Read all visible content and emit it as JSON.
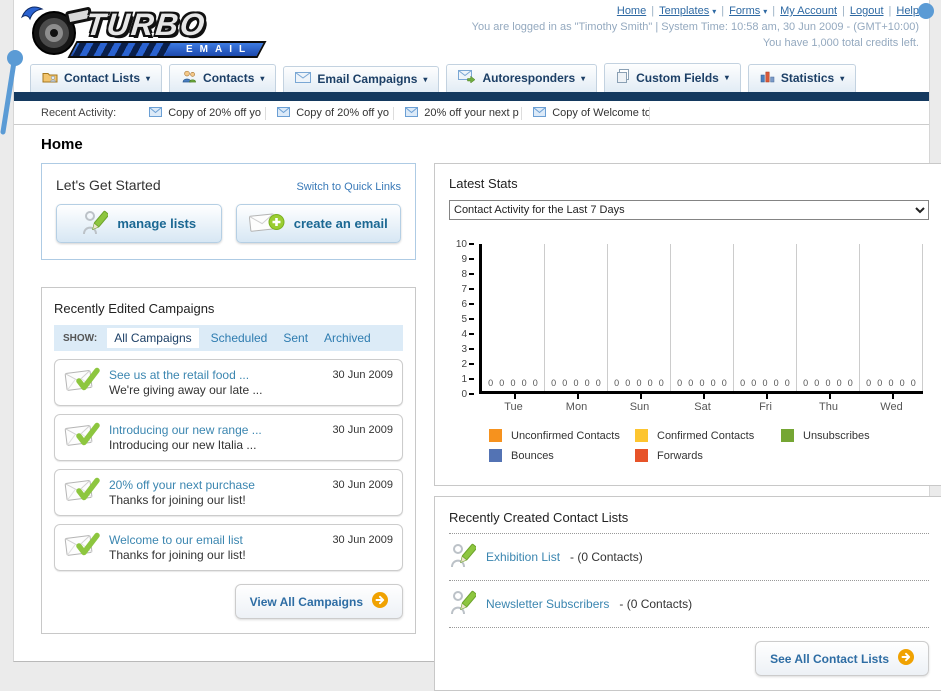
{
  "logo": {
    "title": "TURBO",
    "subtitle": "EMAIL"
  },
  "header": {
    "links": [
      {
        "label": "Home",
        "dropdown": false
      },
      {
        "label": "Templates",
        "dropdown": true
      },
      {
        "label": "Forms",
        "dropdown": true
      },
      {
        "label": "My Account",
        "dropdown": false
      },
      {
        "label": "Logout",
        "dropdown": false
      },
      {
        "label": "Help",
        "dropdown": false
      }
    ],
    "login_line": "You are logged in as \"Timothy Smith\" | System Time: 10:58 am, 30 Jun 2009 - (GMT+10:00)",
    "credits_line": "You have 1,000 total credits left."
  },
  "nav_tabs": [
    {
      "label": "Contact Lists",
      "icon": "contact-lists-icon"
    },
    {
      "label": "Contacts",
      "icon": "contacts-icon"
    },
    {
      "label": "Email Campaigns",
      "icon": "email-campaigns-icon"
    },
    {
      "label": "Autoresponders",
      "icon": "autoresponders-icon"
    },
    {
      "label": "Custom Fields",
      "icon": "custom-fields-icon"
    },
    {
      "label": "Statistics",
      "icon": "statistics-icon"
    }
  ],
  "recent_activity": {
    "label": "Recent Activity:",
    "items": [
      "Copy of 20% off yo",
      "Copy of 20% off yo",
      "20% off your next p",
      "Copy of Welcome to"
    ]
  },
  "page_title": "Home",
  "get_started": {
    "title": "Let's Get Started",
    "switch_link": "Switch to Quick Links",
    "buttons": [
      {
        "label": "manage lists",
        "icon": "manage-lists-icon"
      },
      {
        "label": "create an email",
        "icon": "create-email-icon"
      }
    ]
  },
  "campaigns": {
    "title": "Recently Edited Campaigns",
    "show_label": "SHOW:",
    "filters": [
      {
        "label": "All Campaigns",
        "active": true
      },
      {
        "label": "Scheduled",
        "active": false
      },
      {
        "label": "Sent",
        "active": false
      },
      {
        "label": "Archived",
        "active": false
      }
    ],
    "items": [
      {
        "title": "See us at the retail food ...",
        "subtitle": "We're giving away our late ...",
        "date": "30 Jun 2009"
      },
      {
        "title": "Introducing our new range ...",
        "subtitle": "Introducing our new Italia ...",
        "date": "30 Jun 2009"
      },
      {
        "title": "20% off your next purchase",
        "subtitle": "Thanks for joining our list!",
        "date": "30 Jun 2009"
      },
      {
        "title": "Welcome to our email list",
        "subtitle": "Thanks for joining our list!",
        "date": "30 Jun 2009"
      }
    ],
    "view_all_label": "View All Campaigns"
  },
  "stats": {
    "title": "Latest Stats",
    "dropdown_value": "Contact Activity for the Last 7 Days"
  },
  "chart_data": {
    "type": "bar",
    "title": "Contact Activity for the Last 7 Days",
    "categories": [
      "Tue",
      "Mon",
      "Sun",
      "Sat",
      "Fri",
      "Thu",
      "Wed"
    ],
    "series": [
      {
        "name": "Unconfirmed Contacts",
        "color": "#f6921e",
        "values": [
          0,
          0,
          0,
          0,
          0,
          0,
          0
        ]
      },
      {
        "name": "Confirmed Contacts",
        "color": "#fdc52f",
        "values": [
          0,
          0,
          0,
          0,
          0,
          0,
          0
        ]
      },
      {
        "name": "Unsubscribes",
        "color": "#75a634",
        "values": [
          0,
          0,
          0,
          0,
          0,
          0,
          0
        ]
      },
      {
        "name": "Bounces",
        "color": "#5373b4",
        "values": [
          0,
          0,
          0,
          0,
          0,
          0,
          0
        ]
      },
      {
        "name": "Forwards",
        "color": "#e75329",
        "values": [
          0,
          0,
          0,
          0,
          0,
          0,
          0
        ]
      }
    ],
    "ylim": [
      0,
      10
    ],
    "ytick_step": 1,
    "grid": "vertical",
    "legend_position": "bottom",
    "bar_value_labels_shown": true
  },
  "contact_lists": {
    "title": "Recently Created Contact Lists",
    "items": [
      {
        "name": "Exhibition List",
        "detail": "- (0 Contacts)"
      },
      {
        "name": "Newsletter Subscribers",
        "detail": "- (0 Contacts)"
      }
    ],
    "see_all_label": "See All Contact Lists"
  }
}
